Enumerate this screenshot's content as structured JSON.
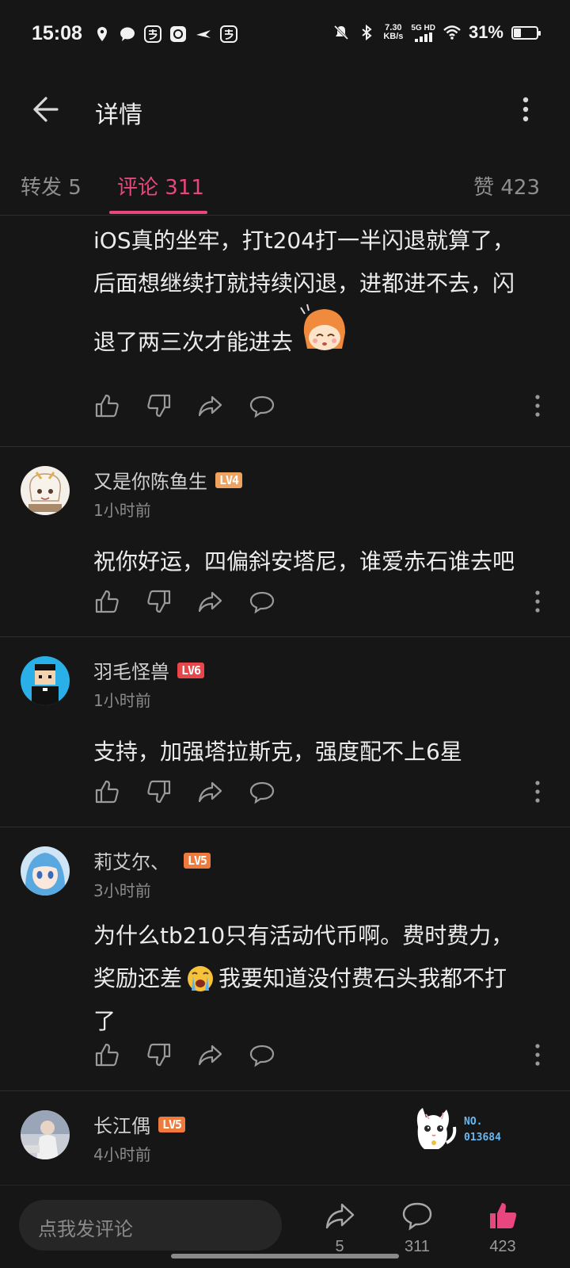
{
  "status_bar": {
    "time": "15:08",
    "net_speed_value": "7.30",
    "net_speed_unit": "KB/s",
    "network": "5G HD",
    "battery_percent": "31%",
    "battery_level": 0.31
  },
  "header": {
    "title": "详情"
  },
  "tabs": {
    "repost": "转发 5",
    "comments": "评论 311",
    "likes": "赞 423"
  },
  "comments": [
    {
      "text_line1": "iOS真的坐牢，打t204打一半闪退就算了，",
      "text_line2": "后面想继续打就持续闪退，进都进不去，闪",
      "text_line3": "退了两三次才能进去"
    },
    {
      "username": "又是你陈鱼生",
      "level": "LV4",
      "level_color": "#f0a35e",
      "time": "1小时前",
      "text": "祝你好运，四偏斜安塔尼，谁爱赤石谁去吧"
    },
    {
      "username": "羽毛怪兽",
      "level": "LV6",
      "level_color": "#e8464a",
      "time": "1小时前",
      "text": "支持，加强塔拉斯克，强度配不上6星"
    },
    {
      "username": "莉艾尔、",
      "level": "LV5",
      "level_color": "#f07a3c",
      "time": "3小时前",
      "text_line1": "为什么tb210只有活动代币啊。费时费力，",
      "text_line2a": "奖励还差",
      "text_line2b": "我要知道没付费石头我都不打",
      "text_line3": "了"
    },
    {
      "username": "长江偶",
      "level": "LV5",
      "level_color": "#f07a3c",
      "time": "4小时前"
    }
  ],
  "overlay_badge": {
    "label": "NO.",
    "number": "013684"
  },
  "bottom_bar": {
    "input_placeholder": "点我发评论",
    "share_count": "5",
    "comment_count": "311",
    "like_count": "423",
    "like_color": "#e8467e"
  }
}
